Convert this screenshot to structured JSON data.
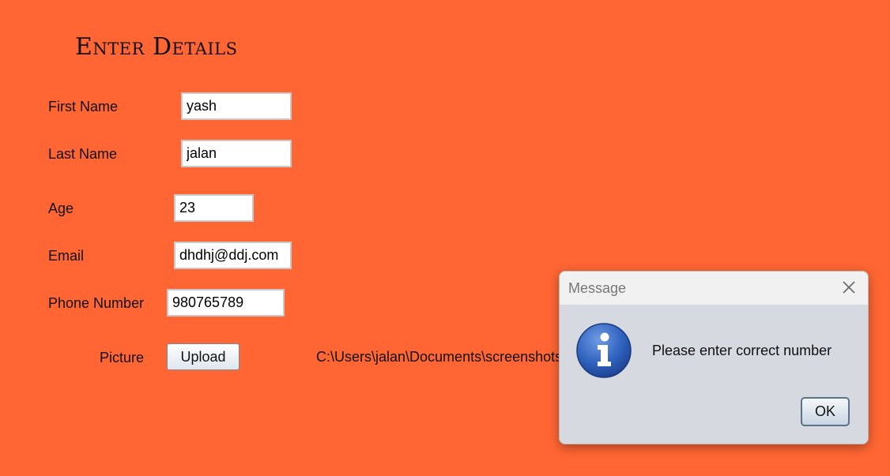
{
  "form": {
    "title": "Enter Details",
    "first_name": {
      "label": "First Name",
      "value": "yash"
    },
    "last_name": {
      "label": "Last Name",
      "value": "jalan"
    },
    "age": {
      "label": "Age",
      "value": "23"
    },
    "email": {
      "label": "Email",
      "value": "dhdhj@ddj.com"
    },
    "phone": {
      "label": "Phone Number",
      "value": "980765789"
    },
    "picture": {
      "label": "Picture",
      "upload_label": "Upload",
      "path": "C:\\Users\\jalan\\Documents\\screenshots"
    },
    "background_color": "#ff6633"
  },
  "dialog": {
    "title": "Message",
    "message": "Please enter correct number",
    "ok_label": "OK",
    "icon": "info-icon",
    "close_icon": "close-icon"
  }
}
